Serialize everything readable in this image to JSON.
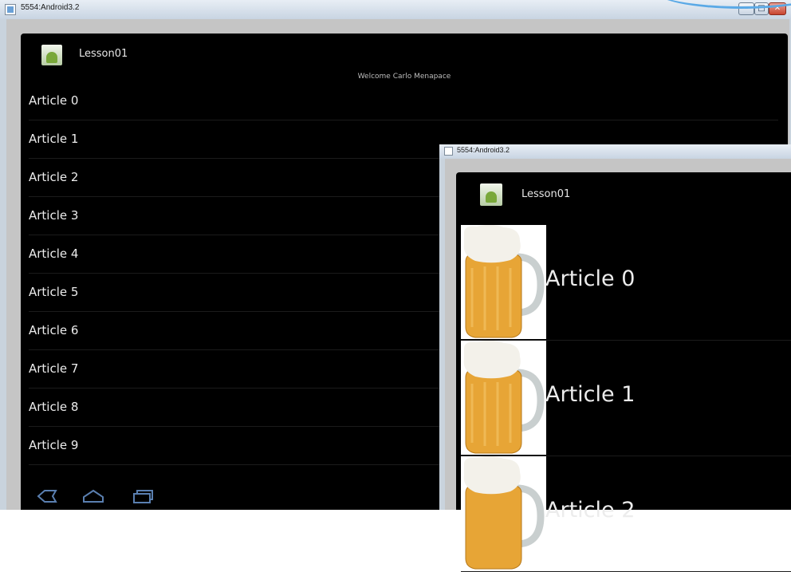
{
  "window_main": {
    "title": "5554:Android3.2",
    "app": {
      "title": "Lesson01",
      "welcome": "Welcome Carlo Menapace",
      "articles": [
        "Article 0",
        "Article 1",
        "Article 2",
        "Article 3",
        "Article 4",
        "Article 5",
        "Article 6",
        "Article 7",
        "Article 8",
        "Article 9"
      ]
    },
    "nav": [
      "back-icon",
      "home-icon",
      "recent-apps-icon"
    ]
  },
  "window_secondary": {
    "title": "5554:Android3.2",
    "app": {
      "title": "Lesson01",
      "articles": [
        "Article 0",
        "Article 1",
        "Article 2"
      ]
    }
  },
  "colors": {
    "screen_bg": "#000000",
    "text": "#ececec",
    "frame": "#c5c5c5",
    "beer": "#e7a536"
  }
}
